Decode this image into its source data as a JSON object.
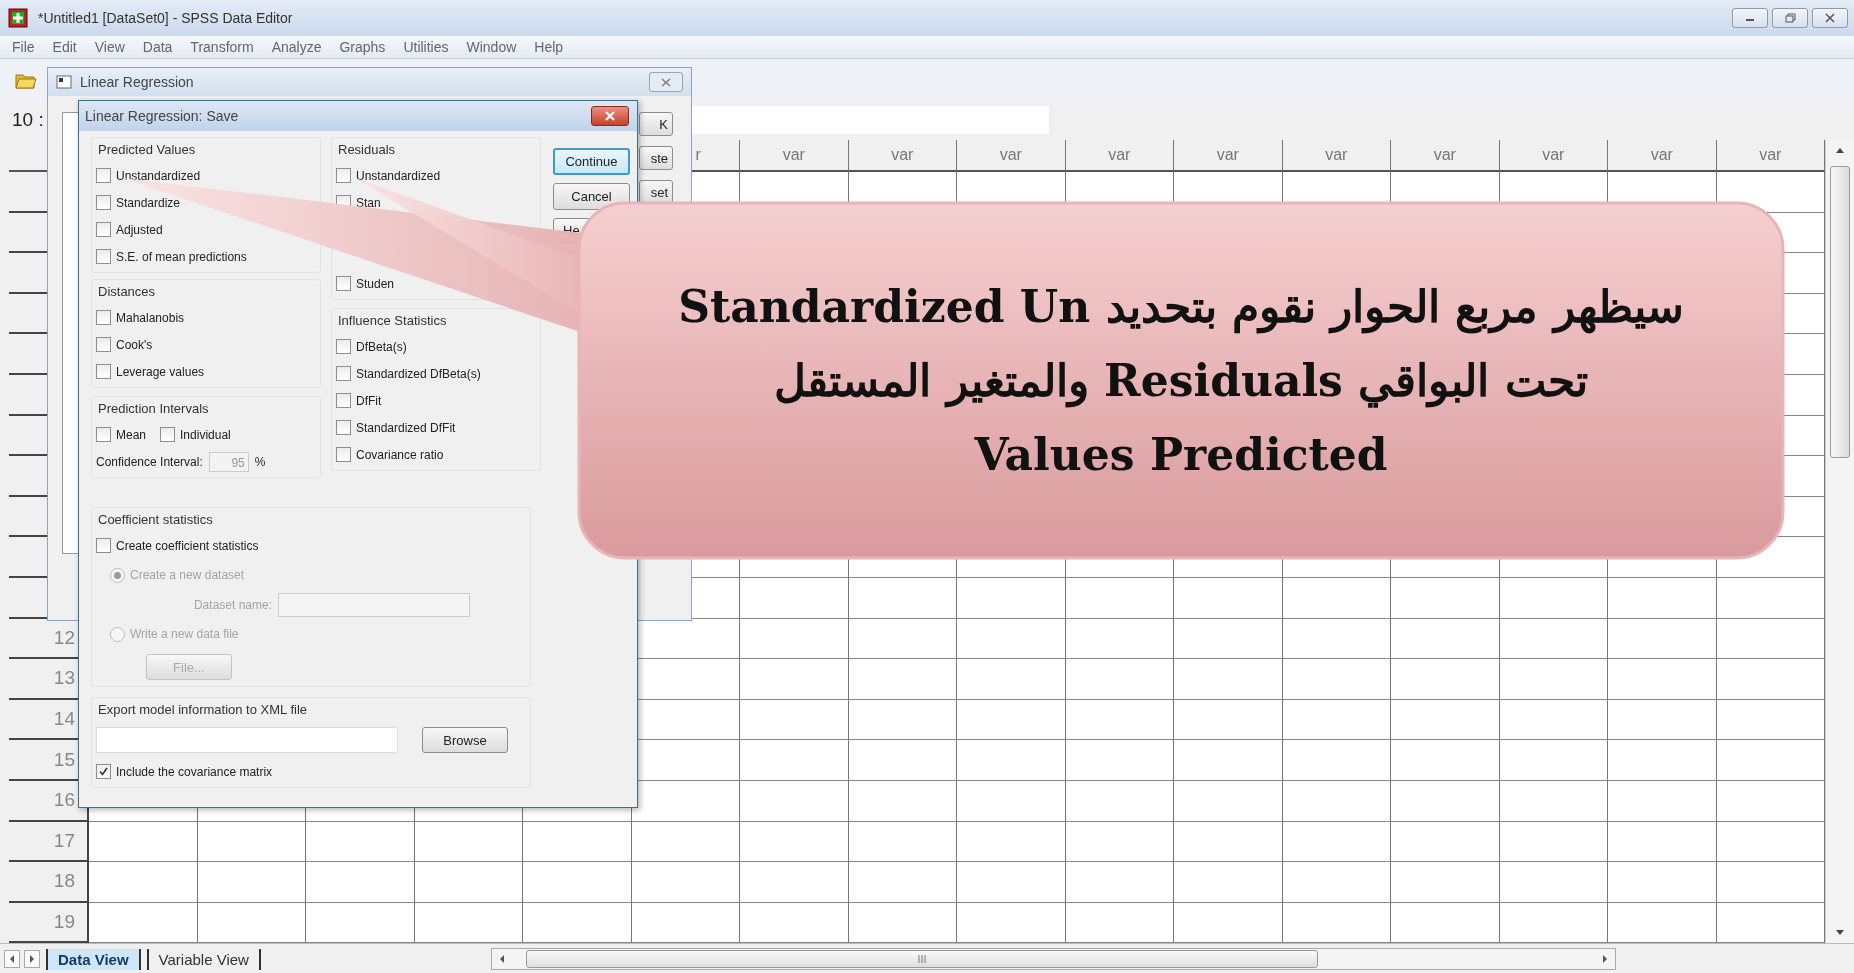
{
  "window": {
    "title": "*Untitled1 [DataSet0] - SPSS Data Editor"
  },
  "menu": [
    "File",
    "Edit",
    "View",
    "Data",
    "Transform",
    "Analyze",
    "Graphs",
    "Utilities",
    "Window",
    "Help"
  ],
  "cell_editor": {
    "label": "10 :"
  },
  "grid": {
    "column_headers": [
      "r",
      "var",
      "var",
      "var",
      "var",
      "var",
      "var",
      "var",
      "var",
      "var",
      "var"
    ],
    "row_numbers": [
      "12",
      "13",
      "14",
      "15",
      "16",
      "17",
      "18",
      "19"
    ]
  },
  "tabs": [
    {
      "label": "Data View",
      "selected": true
    },
    {
      "label": "Variable View",
      "selected": false
    }
  ],
  "back_dialog": {
    "title": "Linear Regression",
    "buttons": [
      "K",
      "ste",
      "set"
    ]
  },
  "save_dialog": {
    "title": "Linear Regression: Save",
    "predicted_values": {
      "title": "Predicted Values",
      "items": [
        {
          "kind": "checkbox",
          "label": "Unstandardized",
          "checked": false
        },
        {
          "kind": "checkbox",
          "label": "Standardize",
          "checked": false
        },
        {
          "kind": "checkbox",
          "label": "Adjusted",
          "checked": false
        },
        {
          "kind": "checkbox",
          "label": "S.E. of mean predictions",
          "checked": false
        }
      ]
    },
    "distances": {
      "title": "Distances",
      "items": [
        {
          "kind": "checkbox",
          "label": "Mahalanobis",
          "checked": false
        },
        {
          "kind": "checkbox",
          "label": "Cook's",
          "checked": false
        },
        {
          "kind": "checkbox",
          "label": "Leverage values",
          "checked": false
        }
      ]
    },
    "prediction_intervals": {
      "title": "Prediction Intervals",
      "items": [
        {
          "label": "Mean",
          "checked": false
        },
        {
          "label": "Individual",
          "checked": false
        }
      ],
      "confidence_label": "Confidence Interval:",
      "confidence_value": "95",
      "unit": "%",
      "disabled": true
    },
    "residuals": {
      "title": "Residuals",
      "items": [
        {
          "kind": "checkbox",
          "label": "Unstandardized",
          "checked": false
        },
        {
          "kind": "checkbox",
          "label": "Stan",
          "checked": false
        },
        {
          "kind": "covered"
        },
        {
          "kind": "covered"
        },
        {
          "kind": "checkbox",
          "label": "Studen",
          "checked": false
        }
      ]
    },
    "influence_statistics": {
      "title": "Influence Statistics",
      "items": [
        {
          "kind": "checkbox",
          "label": "DfBeta(s)",
          "checked": false
        },
        {
          "kind": "checkbox",
          "label": "Standardized DfBeta(s)",
          "checked": false
        },
        {
          "kind": "checkbox",
          "label": "DfFit",
          "checked": false
        },
        {
          "kind": "checkbox",
          "label": "Standardized DfFit",
          "checked": false
        },
        {
          "kind": "checkbox",
          "label": "Covariance ratio",
          "checked": false
        }
      ]
    },
    "buttons": [
      {
        "label": "Continue",
        "default": true
      },
      {
        "label": "Cancel",
        "default": false
      },
      {
        "label": "He",
        "default": false
      }
    ],
    "coefficient_statistics": {
      "title": "Coefficient statistics",
      "create": {
        "label": "Create coefficient statistics",
        "checked": false
      },
      "options": [
        {
          "label": "Create a new dataset",
          "selected": true,
          "disabled": true
        },
        {
          "label": "Write a new data file",
          "selected": false,
          "disabled": true
        }
      ],
      "dataset_name_label": "Dataset name:",
      "file_button": "File...",
      "disabled": true
    },
    "export": {
      "title": "Export model information to XML file",
      "browse": "Browse",
      "include": {
        "label": "Include the covariance matrix",
        "checked": true
      }
    }
  },
  "callout": {
    "text": "سيظهر مربع الحوار نقوم بتحديد Standardized Un\nتحت البواقي Residuals والمتغير المستقل\nValues Predicted"
  }
}
